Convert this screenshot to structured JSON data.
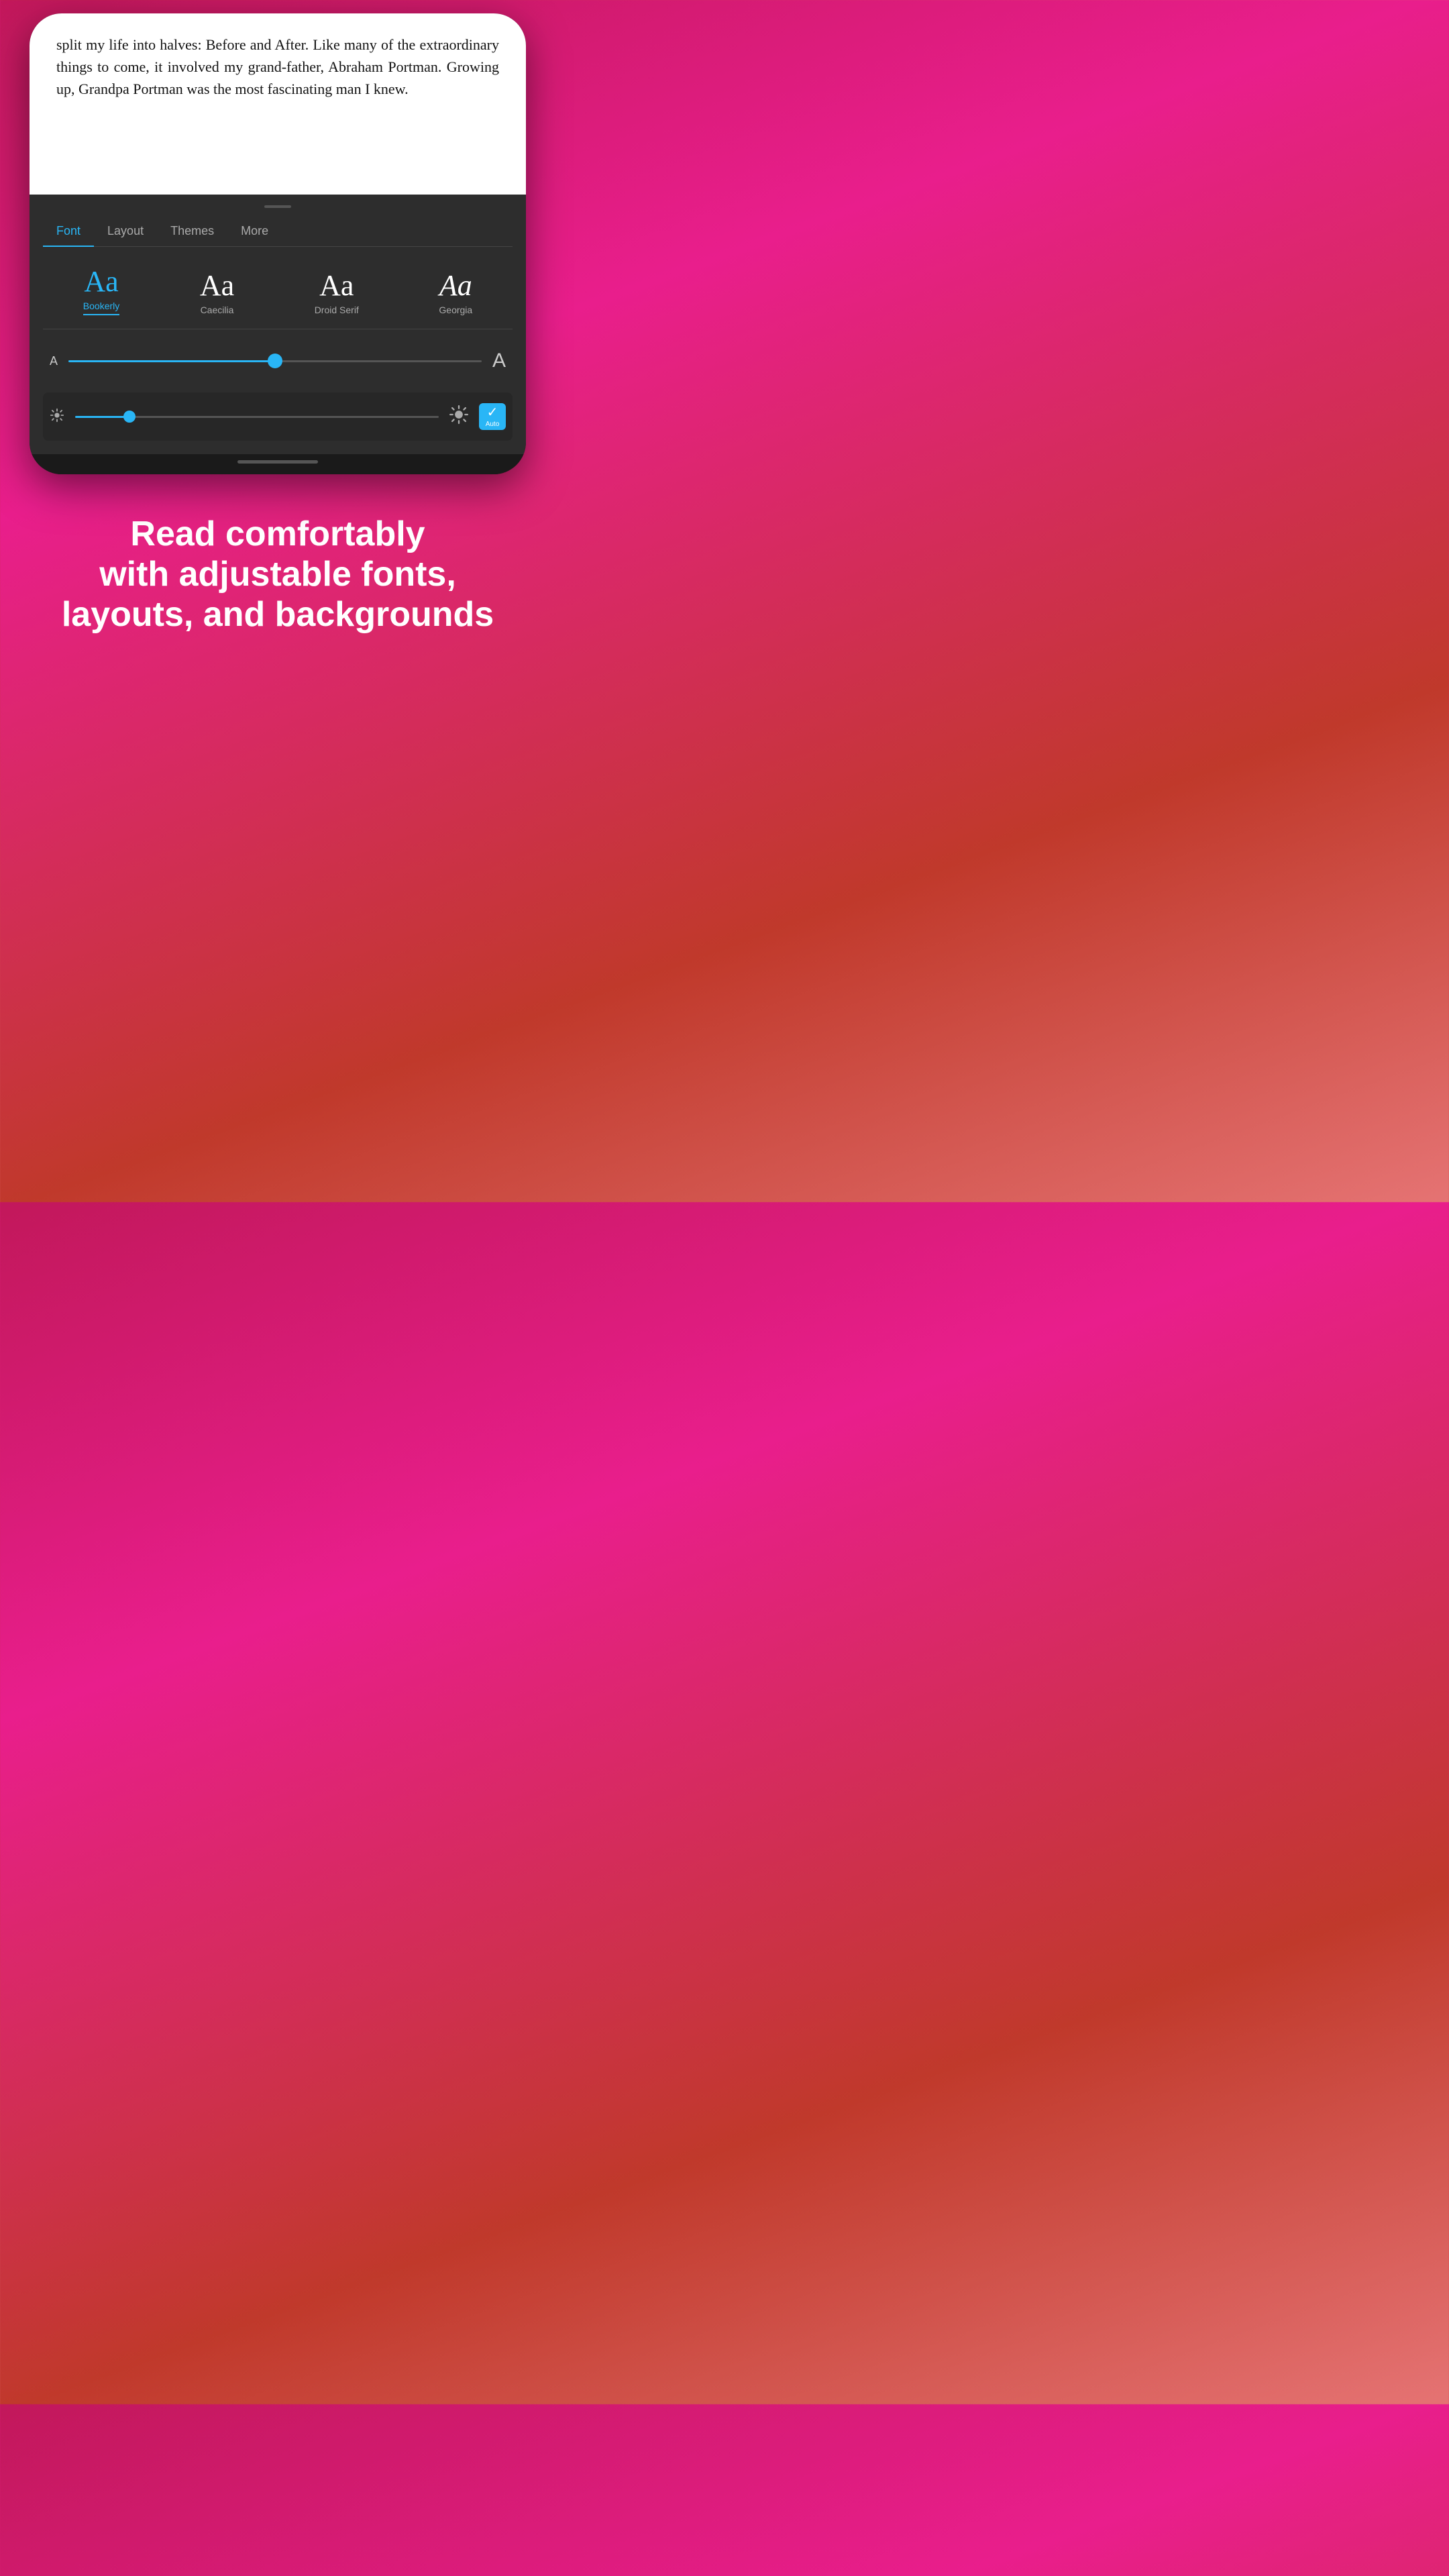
{
  "background": {
    "gradient_start": "#c2185b",
    "gradient_end": "#c0392b"
  },
  "book": {
    "text": "split my life into halves: Before and After. Like many of the extraordinary things to come, it involved my grand-father, Abraham Portman.\n    Growing up, Grandpa Portman was the most fascinating man I knew."
  },
  "tabs": [
    {
      "id": "font",
      "label": "Font",
      "active": true
    },
    {
      "id": "layout",
      "label": "Layout",
      "active": false
    },
    {
      "id": "themes",
      "label": "Themes",
      "active": false
    },
    {
      "id": "more",
      "label": "More",
      "active": false
    }
  ],
  "fonts": [
    {
      "id": "bookerly",
      "sample": "Aa",
      "name": "Bookerly",
      "active": true
    },
    {
      "id": "caecilia",
      "sample": "Aa",
      "name": "Caecilia",
      "active": false
    },
    {
      "id": "droid-serif",
      "sample": "Aa",
      "name": "Droid Serif",
      "active": false
    },
    {
      "id": "georgia",
      "sample": "Aa",
      "name": "Georgia",
      "active": false
    }
  ],
  "font_size": {
    "small_label": "A",
    "large_label": "A",
    "slider_percent": 50
  },
  "brightness": {
    "small_icon": "☀",
    "large_icon": "☀",
    "slider_percent": 15,
    "auto_label": "Auto",
    "auto_enabled": true
  },
  "promo": {
    "line1": "Read comfortably",
    "line2": "with adjustable fonts,",
    "line3": "layouts, and backgrounds"
  }
}
